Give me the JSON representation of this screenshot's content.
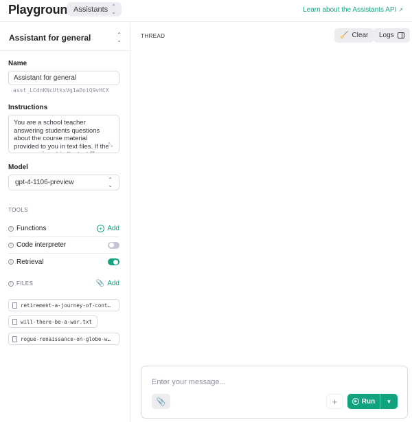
{
  "header": {
    "app_title": "Playground",
    "mode": "Assistants",
    "learn_link": "Learn about the Assistants API",
    "learn_link_icon": "external-arrow"
  },
  "sidebar": {
    "assistant_selector": "Assistant for general",
    "name_label": "Name",
    "name_value": "Assistant for general",
    "assistant_id": "asst_LCdnKNcUtkxVg1aDoiQ9vHCX",
    "instructions_label": "Instructions",
    "instructions_value": "You are a school teacher answering students questions about the course material provided to you in text files. If the  response is not in the text files, say you don't know.",
    "model_label": "Model",
    "model_value": "gpt-4-1106-preview",
    "tools_label": "TOOLS",
    "tools": [
      {
        "label": "Functions",
        "control": "add",
        "control_label": "Add"
      },
      {
        "label": "Code interpreter",
        "control": "toggle",
        "enabled": false
      },
      {
        "label": "Retrieval",
        "control": "toggle",
        "enabled": true
      }
    ],
    "files_label": "FILES",
    "files_add_label": "Add",
    "files": [
      "retirement-a-journey-of-cont…",
      "will-there-be-a-war.txt",
      "rogue-renaissance-on-globe-w…"
    ]
  },
  "thread": {
    "label": "THREAD",
    "clear_label": "Clear",
    "logs_label": "Logs"
  },
  "composer": {
    "placeholder": "Enter your message...",
    "add_symbol": "+",
    "run_label": "Run"
  },
  "colors": {
    "accent": "#10a37f",
    "border": "#d9d9e3",
    "muted_text": "#8e8ea0",
    "button_bg": "#ececf1"
  }
}
